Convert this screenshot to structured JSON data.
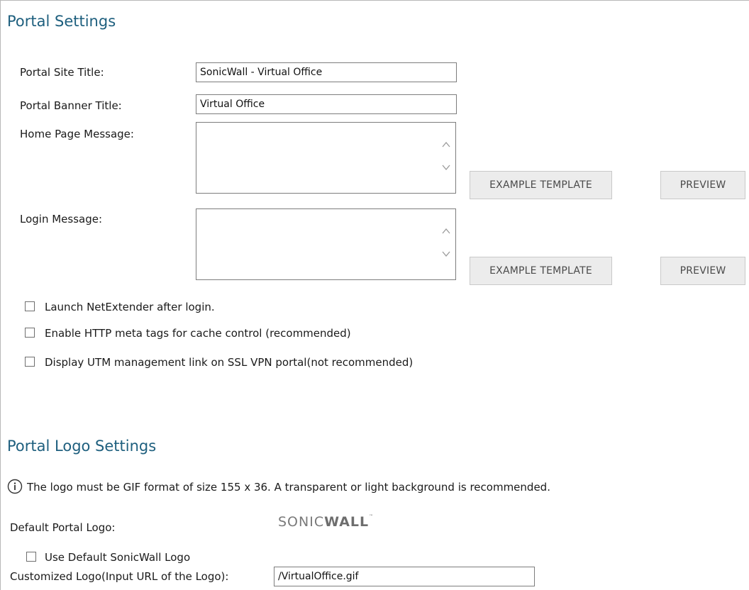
{
  "portal_settings": {
    "heading": "Portal Settings",
    "site_title_label": "Portal Site Title:",
    "site_title_value": "SonicWall - Virtual Office",
    "banner_title_label": "Portal Banner Title:",
    "banner_title_value": "Virtual Office",
    "home_message_label": "Home Page Message:",
    "login_message_label": "Login Message:",
    "example_template_label": "EXAMPLE TEMPLATE",
    "preview_label": "PREVIEW",
    "checkboxes": [
      {
        "label": "Launch NetExtender after login.",
        "checked": false
      },
      {
        "label": "Enable HTTP meta tags for cache control (recommended)",
        "checked": false
      },
      {
        "label": "Display UTM management link on SSL VPN portal(not recommended)",
        "checked": false
      }
    ]
  },
  "logo_settings": {
    "heading": "Portal Logo Settings",
    "info_text": "The logo must be GIF format of size 155 x 36. A transparent or light background is recommended.",
    "default_logo_label": "Default Portal Logo:",
    "logo_text_main": "SONIC",
    "logo_text_accent": "WALL",
    "use_default_label": "Use Default SonicWall Logo",
    "custom_logo_label": "Customized Logo(Input URL of the Logo):",
    "custom_logo_value": "/VirtualOffice.gif"
  },
  "colors": {
    "heading": "#1e5f7e",
    "button_bg": "#ececec",
    "button_text": "#4a4a4a"
  },
  "icons": {
    "info": "info-circle-icon",
    "scroll_up": "chevron-up-icon",
    "scroll_down": "chevron-down-icon"
  }
}
